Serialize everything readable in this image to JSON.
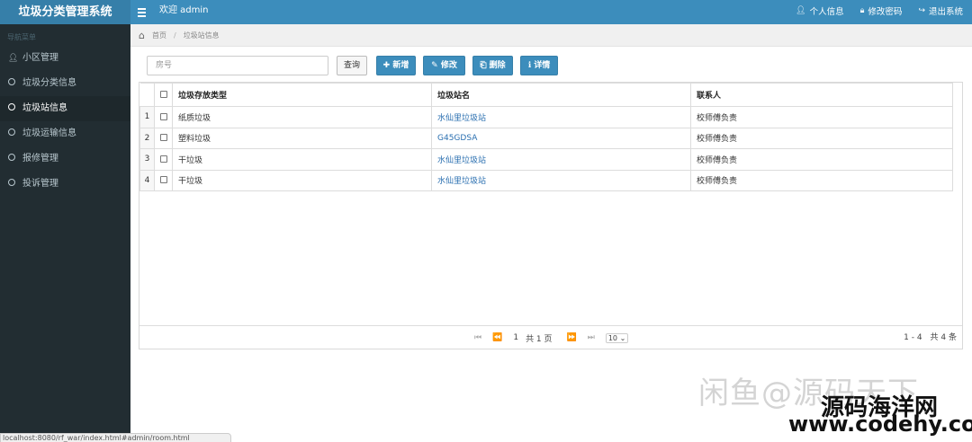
{
  "header": {
    "brand": "垃圾分类管理系统",
    "welcome": "欢迎 admin",
    "nav": [
      {
        "icon": "user-icon",
        "label": "个人信息"
      },
      {
        "icon": "lock-icon",
        "label": "修改密码"
      },
      {
        "icon": "sign-out-icon",
        "label": "退出系统"
      }
    ]
  },
  "sidebar": {
    "heading": "导航菜单",
    "items": [
      {
        "label": "小区管理",
        "icon": "user-icon"
      },
      {
        "label": "垃圾分类信息",
        "icon": "circle-icon"
      },
      {
        "label": "垃圾站信息",
        "icon": "circle-icon",
        "active": true
      },
      {
        "label": "垃圾运输信息",
        "icon": "circle-icon"
      },
      {
        "label": "报修管理",
        "icon": "circle-icon"
      },
      {
        "label": "投诉管理",
        "icon": "circle-icon"
      }
    ]
  },
  "breadcrumb": {
    "home": "首页",
    "current": "垃圾站信息"
  },
  "toolbar": {
    "search_placeholder": "房号",
    "query": "查询",
    "add": "新增",
    "edit": "修改",
    "delete": "删除",
    "detail": "详情"
  },
  "table": {
    "columns": [
      "垃圾存放类型",
      "垃圾站名",
      "联系人"
    ],
    "rows": [
      {
        "n": "1",
        "type": "纸质垃圾",
        "station": "水仙里垃圾站",
        "contact": "校师傅负责"
      },
      {
        "n": "2",
        "type": "塑料垃圾",
        "station": "G45GDSA",
        "contact": "校师傅负责"
      },
      {
        "n": "3",
        "type": "干垃圾",
        "station": "水仙里垃圾站",
        "contact": "校师傅负责"
      },
      {
        "n": "4",
        "type": "干垃圾",
        "station": "水仙里垃圾站",
        "contact": "校师傅负责"
      }
    ]
  },
  "pager": {
    "page": "1",
    "total_pages": "共 1 页",
    "page_size": "10",
    "summary": "1 - 4　共 4 条"
  },
  "watermark": {
    "line1": "闲鱼@源码天下",
    "line2": "源码海洋网",
    "line3": "www.codehy.com"
  },
  "statusbar": "localhost:8080/rf_war/index.html#admin/room.html",
  "colors": {
    "header": "#3c8dbc",
    "brand": "#367fa9",
    "sidebar": "#222d32",
    "button": "#3c8dbc",
    "link": "#2a6fb0"
  }
}
